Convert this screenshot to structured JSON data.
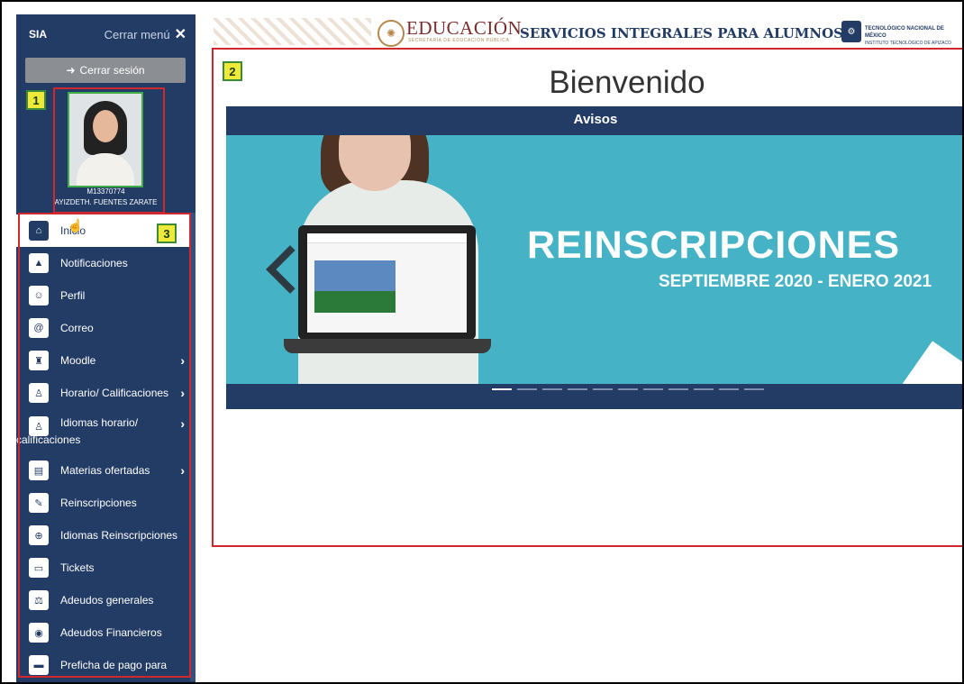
{
  "sidebar": {
    "brand": "SIA",
    "close_menu": "Cerrar menú",
    "logout": "Cerrar sesión",
    "profile": {
      "id": "M13370774",
      "name": "AYIZDETH. FUENTES ZARATE"
    },
    "items": [
      {
        "label": "Inicio",
        "icon": "home-icon",
        "glyph": "⌂",
        "active": true
      },
      {
        "label": "Notificaciones",
        "icon": "bell-icon",
        "glyph": "▲"
      },
      {
        "label": "Perfil",
        "icon": "user-edit-icon",
        "glyph": "☺"
      },
      {
        "label": "Correo",
        "icon": "at-icon",
        "glyph": "@"
      },
      {
        "label": "Moodle",
        "icon": "graduation-icon",
        "glyph": "♜",
        "submenu": true
      },
      {
        "label": "Horario/ Calificaciones",
        "icon": "award-icon",
        "glyph": "♙",
        "submenu": true
      },
      {
        "label_line1": "Idiomas horario/",
        "label_line2": "calificaciones",
        "icon": "award-icon",
        "glyph": "♙",
        "submenu": true
      },
      {
        "label": "Materias ofertadas",
        "icon": "clipboard-icon",
        "glyph": "▤",
        "submenu": true
      },
      {
        "label": "Reinscripciones",
        "icon": "pen-paper-icon",
        "glyph": "✎"
      },
      {
        "label": "Idiomas Reinscripciones",
        "icon": "globe-icon",
        "glyph": "⊕"
      },
      {
        "label": "Tickets",
        "icon": "ticket-icon",
        "glyph": "▭"
      },
      {
        "label": "Adeudos generales",
        "icon": "scale-icon",
        "glyph": "⚖"
      },
      {
        "label": "Adeudos Financieros",
        "icon": "coins-icon",
        "glyph": "◉"
      },
      {
        "label": "Preficha de pago para",
        "icon": "card-icon",
        "glyph": "▬"
      }
    ]
  },
  "header": {
    "edu": "EDUCACIÓN",
    "edu_sub": "SECRETARÍA DE EDUCACIÓN PÚBLICA",
    "title": "SERVICIOS INTEGRALES PARA ALUMNOS",
    "tec_line1": "TECNOLÓGICO NACIONAL DE MÉXICO",
    "tec_line2": "INSTITUTO TECNOLÓGICO DE APIZACO"
  },
  "main": {
    "welcome": "Bienvenido",
    "avisos_title": "Avisos",
    "slide": {
      "headline": "REINSCRIPCIONES",
      "period": "SEPTIEMBRE 2020 - ENERO 2021"
    },
    "indicators": 11,
    "active_indicator": 0
  },
  "annotations": [
    "1",
    "2",
    "3"
  ],
  "colors": {
    "sidebar_bg": "#233c66",
    "slide_bg": "#45b2c6",
    "highlight_red": "#d2282d",
    "badge_yellow": "#efe93a",
    "photo_border": "#3fae49"
  }
}
